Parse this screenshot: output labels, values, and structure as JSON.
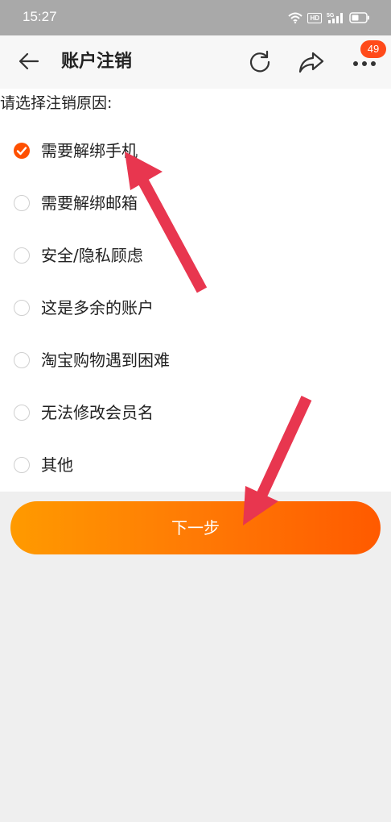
{
  "status_bar": {
    "time": "15:27",
    "icons": [
      "wifi-icon",
      "hd-badge",
      "signal-5g-icon",
      "battery-icon"
    ],
    "hd_label": "HD",
    "network_label": "5G"
  },
  "header": {
    "title": "账户注销",
    "icons": [
      "back-arrow-icon",
      "refresh-icon",
      "share-icon",
      "more-icon"
    ],
    "badge_count": "49"
  },
  "form": {
    "prompt": "请选择注销原因:",
    "reasons": [
      {
        "label": "需要解绑手机",
        "checked": true
      },
      {
        "label": "需要解绑邮箱",
        "checked": false
      },
      {
        "label": "安全/隐私顾虑",
        "checked": false
      },
      {
        "label": "这是多余的账户",
        "checked": false
      },
      {
        "label": "淘宝购物遇到困难",
        "checked": false
      },
      {
        "label": "无法修改会员名",
        "checked": false
      },
      {
        "label": "其他",
        "checked": false
      }
    ],
    "next_label": "下一步"
  },
  "colors": {
    "accent": "#ff5000",
    "button_start": "#ff9a00",
    "button_end": "#ff5a00",
    "annotation_arrow": "#e8364f",
    "badge": "#ff4a1a"
  }
}
